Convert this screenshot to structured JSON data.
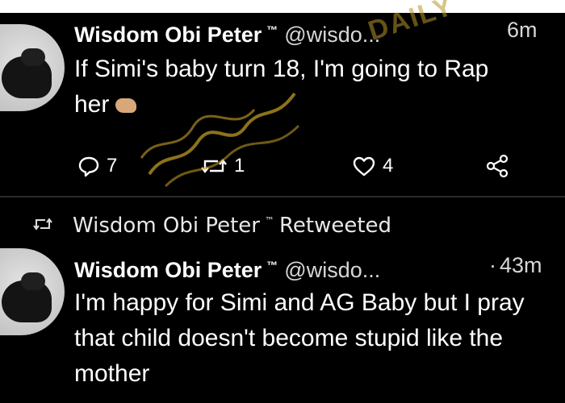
{
  "tweets": [
    {
      "author_name": "Wisdom Obi Peter",
      "author_badge": "™",
      "author_handle": "@wisdo...",
      "time": "6m",
      "text": "If Simi's baby turn 18, I'm going to Rap her",
      "text_line1": "If Simi's baby turn 18, I'm going to Rap",
      "text_line2": "her",
      "emoji": "folded-hands-emoji",
      "reply_count": "7",
      "retweet_count": "1",
      "like_count": "4"
    },
    {
      "retweeted_by_label": "Wisdom Obi Peter",
      "retweeted_badge": "™",
      "retweeted_suffix": "Retweeted",
      "author_name": "Wisdom Obi Peter",
      "author_badge": "™",
      "author_handle": "@wisdo...",
      "time_separator": "·",
      "time": "43m",
      "text": "I'm happy for Simi and AG Baby but I pray that child doesn't become stupid like the mother"
    }
  ],
  "colors": {
    "background": "#000000",
    "text": "#ffffff",
    "muted_text": "#d7d7d7",
    "divider": "#2a2a2a",
    "scribble": "#c9a227"
  },
  "icons": [
    "reply-icon",
    "retweet-icon",
    "like-icon",
    "share-icon",
    "retweet-indicator-icon"
  ]
}
